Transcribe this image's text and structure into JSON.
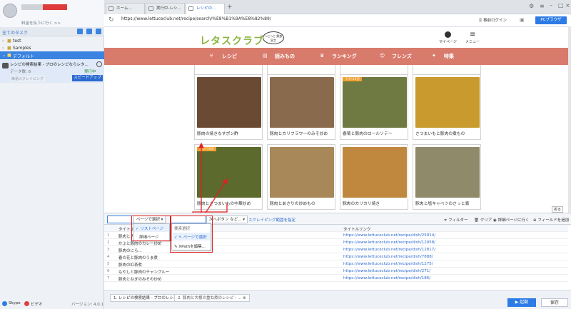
{
  "sidebar": {
    "plan_text": "料金を払うに行く >>",
    "all_tasks": "全てのタスク",
    "tree": [
      "test",
      "Samples",
      "デフォルト"
    ],
    "task": {
      "title": "レシピの検索結果 - プロのレシピならレタ...",
      "count_label": "データ数",
      "count": "8",
      "status": "実行中",
      "tag": "簡易スクレイピング",
      "speed_label": "スピードアップ"
    },
    "skype": "Skype",
    "video": "ビデオ",
    "version": "バージョン: 4.0.1"
  },
  "browser": {
    "tabs": [
      "ホーム...",
      "実行中-レシ...",
      "レシピの..."
    ],
    "url": "https://www.lettuceclub.net/recipe/search/%E8%B1%9A%E8%82%89/",
    "login_label": "事前ログイン",
    "pc_label": "PCブラウザ"
  },
  "site": {
    "logo": "レタスクラブ",
    "badge": "へとへと 解放宣言",
    "mypage": "マイページ",
    "menu": "メニュー",
    "nav": [
      "レシピ",
      "読みもの",
      "ランキング",
      "フレンズ",
      "特集"
    ],
    "cards": [
      {
        "cap": "豚肉の焼きなすポン酢",
        "color": "#6b4a34",
        "tag": ""
      },
      {
        "cap": "豚肉とカリフラワーのみそ炒め",
        "color": "#8a6a4d",
        "tag": ""
      },
      {
        "cap": "春菊と豚肉のロールソテー",
        "color": "#6f7a42",
        "tag": "ラク!15分"
      },
      {
        "cap": "さつまいもと豚肉の煮もの",
        "color": "#c99a2d",
        "tag": ""
      },
      {
        "cap": "豚肉とさつまいもの中華炒め",
        "color": "#5c6a2e",
        "tag": "ラク!15分"
      },
      {
        "cap": "豚肉とあさりの炒めもの",
        "color": "#a88858",
        "tag": ""
      },
      {
        "cap": "豚肉のカリカリ焼き",
        "color": "#c0883e",
        "tag": ""
      },
      {
        "cap": "豚肉と塩キャベツのさっと煮",
        "color": "#8f8a6a",
        "tag": ""
      }
    ],
    "collapse_label": "折る"
  },
  "tool": {
    "type_label": "ページタイプ",
    "page_select": "ページで選択",
    "page_click": "ページ要素の選",
    "btn_select": "次へボタン など...",
    "range_label": "スクレイピング範囲を指定",
    "filter": "フィルター",
    "clear": "クリア",
    "detail": "詳細ページに行く",
    "add_field": "フィールドを追加"
  },
  "dropdown1": {
    "items": [
      "リストページ",
      "詳細ページ"
    ]
  },
  "dropdown2": {
    "title": "要素選択",
    "items": [
      "ページで選択",
      "XPathを編集..."
    ]
  },
  "table": {
    "col1": "タイトル",
    "col2": "タイトルリンク",
    "rows": [
      {
        "n": "1",
        "t": "豚肉と大根...",
        "l": "https://www.lettuceclub.net/recipe/dish/25914/"
      },
      {
        "n": "2",
        "t": "かぶと豚肉のカレー炒め",
        "l": "https://www.lettuceclub.net/recipe/dish/12958/"
      },
      {
        "n": "3",
        "t": "豚肉のにら...",
        "l": "https://www.lettuceclub.net/recipe/dish/12817/"
      },
      {
        "n": "4",
        "t": "春の花と豚肉のうま煮",
        "l": "https://www.lettuceclub.net/recipe/dish/7888/"
      },
      {
        "n": "5",
        "t": "豚肉の紅茶煮",
        "l": "https://www.lettuceclub.net/recipe/dish/1275/"
      },
      {
        "n": "6",
        "t": "もやしと豚肉のチャンプルー",
        "l": "https://www.lettuceclub.net/recipe/dish/271/"
      },
      {
        "n": "7",
        "t": "豚肉とねぎのみその炒め",
        "l": "https://www.lettuceclub.net/recipe/dish/186/"
      }
    ]
  },
  "bottom": {
    "tab1": "1. レシピの検索結果 - プロのレシ...",
    "tab2": "2. 豚肉と大根の重ね煮のレシピ・...",
    "start": "起動",
    "save": "保存"
  }
}
